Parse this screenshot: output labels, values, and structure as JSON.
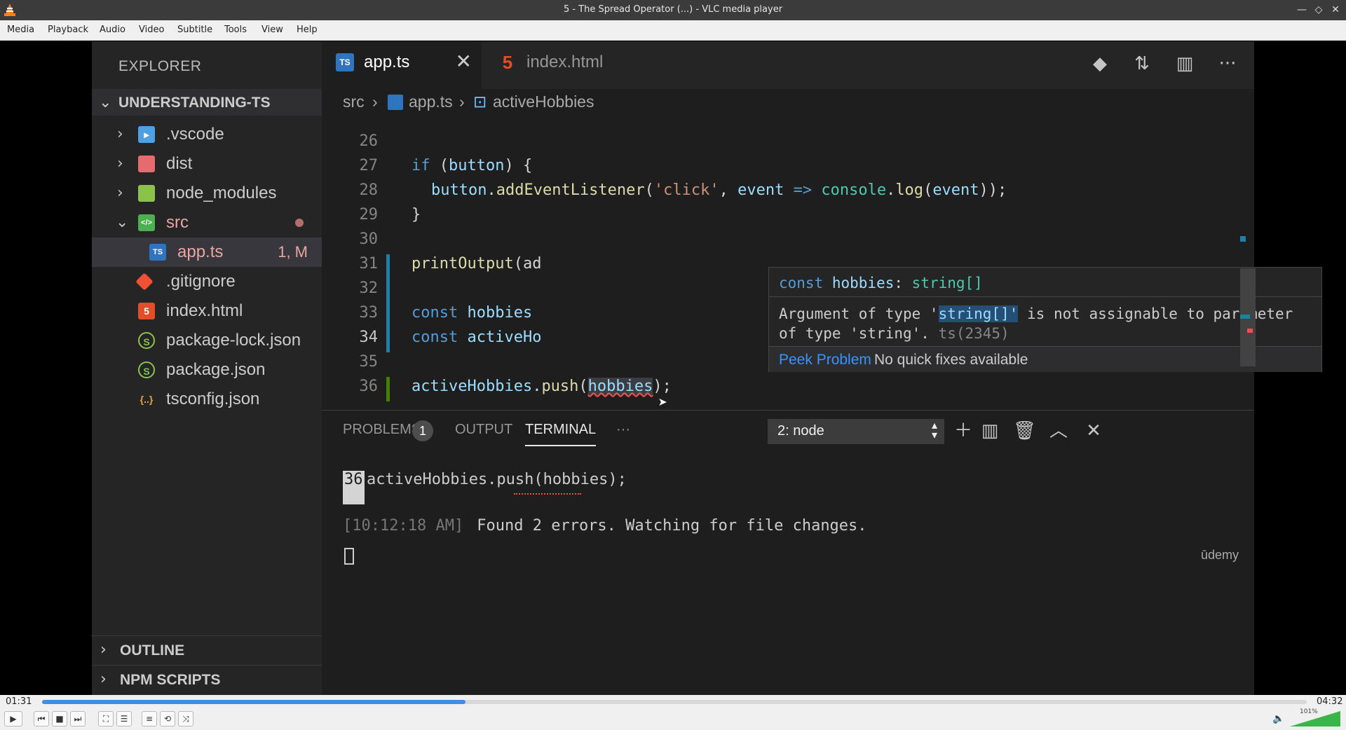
{
  "window": {
    "title": "5 - The Spread Operator (...) - VLC media player",
    "minimize": "—",
    "restore": "◇",
    "close": "✕"
  },
  "menu": [
    "Media",
    "Playback",
    "Audio",
    "Video",
    "Subtitle",
    "Tools",
    "View",
    "Help"
  ],
  "vscode": {
    "explorer_header": "EXPLORER",
    "project": "UNDERSTANDING-TS",
    "tree": [
      {
        "name": ".vscode",
        "icon": "vscode-folder-icon",
        "badge": ""
      },
      {
        "name": "dist",
        "icon": "dist-folder-icon",
        "badge": ""
      },
      {
        "name": "node_modules",
        "icon": "node-folder-icon",
        "badge": ""
      },
      {
        "name": "src",
        "icon": "src-folder-icon",
        "badge": ""
      },
      {
        "name": "app.ts",
        "icon": "typescript-file-icon",
        "badge": "1, M"
      },
      {
        "name": ".gitignore",
        "icon": "git-icon",
        "badge": ""
      },
      {
        "name": "index.html",
        "icon": "html-file-icon",
        "badge": ""
      },
      {
        "name": "package-lock.json",
        "icon": "json-file-icon",
        "badge": ""
      },
      {
        "name": "package.json",
        "icon": "json-file-icon",
        "badge": ""
      },
      {
        "name": "tsconfig.json",
        "icon": "json-braces-icon",
        "badge": ""
      }
    ],
    "sections": [
      "OUTLINE",
      "NPM SCRIPTS"
    ],
    "tabs": [
      {
        "label": "app.ts",
        "icon_text": "TS"
      },
      {
        "label": "index.html",
        "icon_text": "5"
      }
    ],
    "breadcrumb": [
      "src",
      "app.ts",
      "activeHobbies"
    ],
    "line_numbers": [
      "26",
      "27",
      "28",
      "29",
      "30",
      "31",
      "32",
      "33",
      "34",
      "35",
      "36"
    ],
    "code": {
      "l27_a": "if",
      "l27_b": " (",
      "l27_c": "button",
      "l27_d": ") {",
      "l28_a": "button",
      "l28_b": ".",
      "l28_c": "addEventListener",
      "l28_d": "(",
      "l28_e": "'click'",
      "l28_f": ", ",
      "l28_g": "event",
      "l28_h": " => ",
      "l28_i": "console",
      "l28_j": ".",
      "l28_k": "log",
      "l28_l": "(",
      "l28_m": "event",
      "l28_n": "));",
      "l29": "}",
      "l31_a": "printOutput",
      "l31_b": "(ad",
      "l33_a": "const",
      "l33_b": " hobbies",
      "l34_a": "const",
      "l34_b": " activeHo",
      "l36_a": "activeHobbies",
      "l36_b": ".",
      "l36_c": "push",
      "l36_d": "(",
      "l36_e": "hobbies",
      "l36_f": ");"
    },
    "hover": {
      "sig_kw": "const",
      "sig_name": " hobbies",
      "sig_colon": ": ",
      "sig_type": "string[]",
      "msg_a": "Argument of type '",
      "msg_hl": "string[]'",
      "msg_b": " is not assignable to parameter of type 'string'. ",
      "msg_code": "ts(2345)",
      "peek": "Peek Problem",
      "nofix": "No quick fixes available"
    },
    "panel": {
      "problems": "PROBLEMS",
      "problems_count": "1",
      "output": "OUTPUT",
      "terminal": "TERMINAL",
      "more": "···",
      "terminal_select": "2: node",
      "term_lineno": "36",
      "term_code": "activeHobbies.push(hobbies);",
      "term_time": "[10:12:18 AM]",
      "term_msg": " Found 2 errors. Watching for file changes.",
      "watermark": "ūdemy"
    }
  },
  "player": {
    "elapsed": "01:31",
    "total": "04:32",
    "progress": 0.335,
    "volume": "101%"
  }
}
